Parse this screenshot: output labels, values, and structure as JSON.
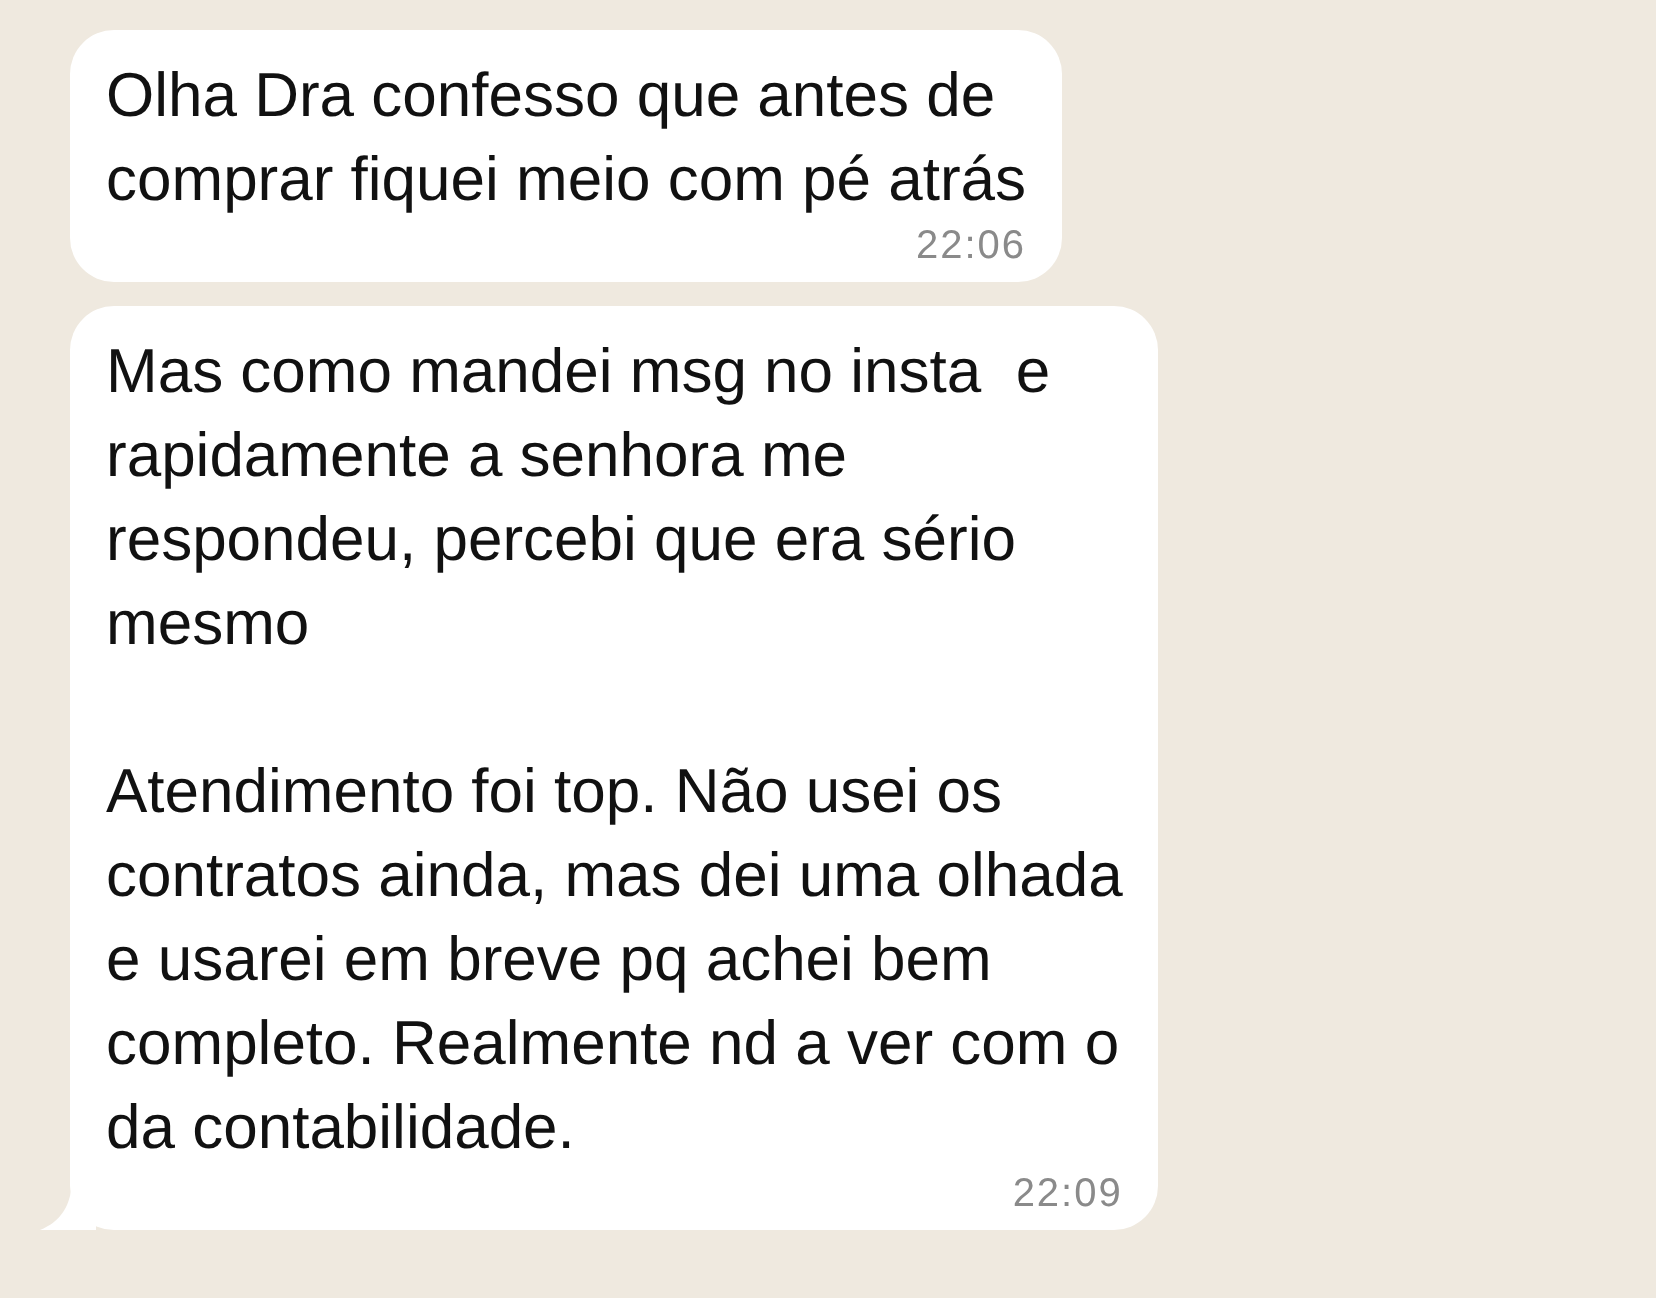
{
  "messages": [
    {
      "text": "Olha Dra confesso que antes de\ncomprar fiquei meio com pé atrás",
      "time": "22:06",
      "tail": false
    },
    {
      "text": "Mas como mandei msg no insta  e\nrapidamente a senhora me\nrespondeu, percebi que era sério\nmesmo\n\nAtendimento foi top. Não usei os\ncontratos ainda, mas dei uma olhada\ne usarei em breve pq achei bem\ncompleto. Realmente nd a ver com o\nda contabilidade.",
      "time": "22:09",
      "tail": true
    }
  ]
}
